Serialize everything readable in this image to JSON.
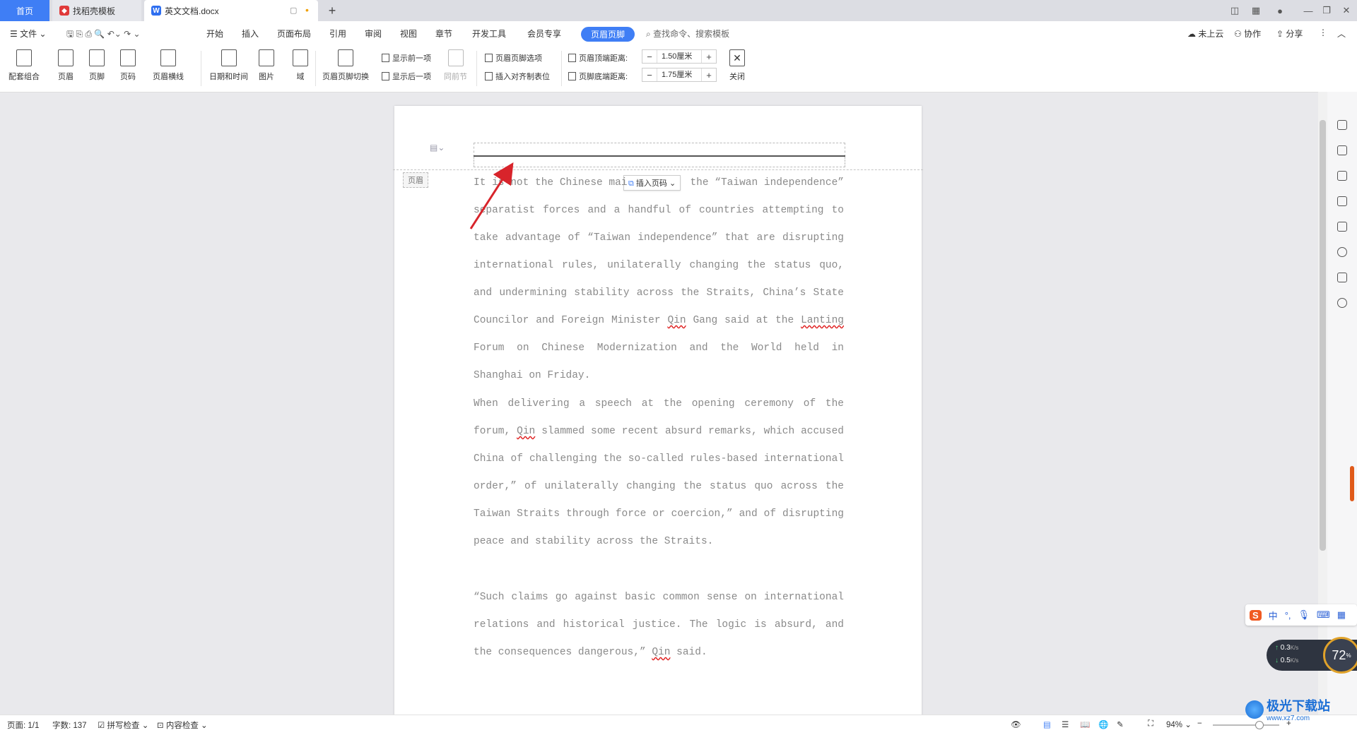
{
  "tabs": {
    "home": "首页",
    "template": "找稻壳模板",
    "doc": "英文文档.docx",
    "new_tab": "+"
  },
  "menubar": {
    "file": "文件",
    "items": [
      "开始",
      "插入",
      "页面布局",
      "引用",
      "审阅",
      "视图",
      "章节",
      "开发工具",
      "会员专享"
    ],
    "active": "页眉页脚",
    "search_placeholder": "查找命令、搜索模板",
    "cloud": "未上云",
    "collab": "协作",
    "share": "分享"
  },
  "ribbon": {
    "combo": "配套组合",
    "header": "页眉",
    "footer": "页脚",
    "page_num": "页码",
    "header_line": "页眉横线",
    "datetime": "日期和时间",
    "picture": "图片",
    "field": "域",
    "switch": "页眉页脚切换",
    "show_prev": "显示前一项",
    "show_next": "显示后一项",
    "same_prev": "同前节",
    "hf_options": "页眉页脚选项",
    "insert_tab": "插入对齐制表位",
    "top_dist_label": "页眉顶端距离:",
    "top_dist_value": "1.50厘米",
    "bottom_dist_label": "页脚底端距离:",
    "bottom_dist_value": "1.75厘米",
    "close": "关闭"
  },
  "document": {
    "header_label": "页眉",
    "insert_page_num": "插入页码",
    "p1_line1": "It is not the Chinese mai",
    "p1_line1b": "the “Taiwan independence”",
    "p1_rest_a": "separatist forces and a handful of countries attempting to take advantage of “Taiwan independence” that are disrupting international rules, unilaterally changing the status quo, and undermining stability across the Straits, China’s State Councilor and Foreign Minister ",
    "p1_qin": "Qin",
    "p1_rest_b": " Gang said at the ",
    "p1_lanting": "Lanting",
    "p1_rest_c": " Forum on Chinese Modernization and the World held in Shanghai on Friday.",
    "p2_a": "When delivering a speech at the opening ceremony of the forum, ",
    "p2_qin": "Qin",
    "p2_b": " slammed some recent absurd remarks, which accused China of challenging the so-called rules-based international order,” of unilaterally changing the status quo across the Taiwan Straits through force or coercion,” and of disrupting peace and stability across the Straits.",
    "p3_a": "“Such claims go against basic common sense on international relations and historical justice. The logic is absurd, and the consequences dangerous,” ",
    "p3_qin": "Qin",
    "p3_b": " said."
  },
  "statusbar": {
    "page": "页面: 1/1",
    "words": "字数: 137",
    "spell": "拼写检查",
    "content": "内容检查",
    "zoom": "94%"
  },
  "widgets": {
    "ime": "中",
    "net_up": "0.3",
    "net_down": "0.5",
    "net_unit": "K/s",
    "cpu": "72",
    "watermark": "极光下载站",
    "watermark_url": "www.xz7.com"
  },
  "colors": {
    "accent": "#3f7ef5",
    "arrow": "#d8242b"
  }
}
